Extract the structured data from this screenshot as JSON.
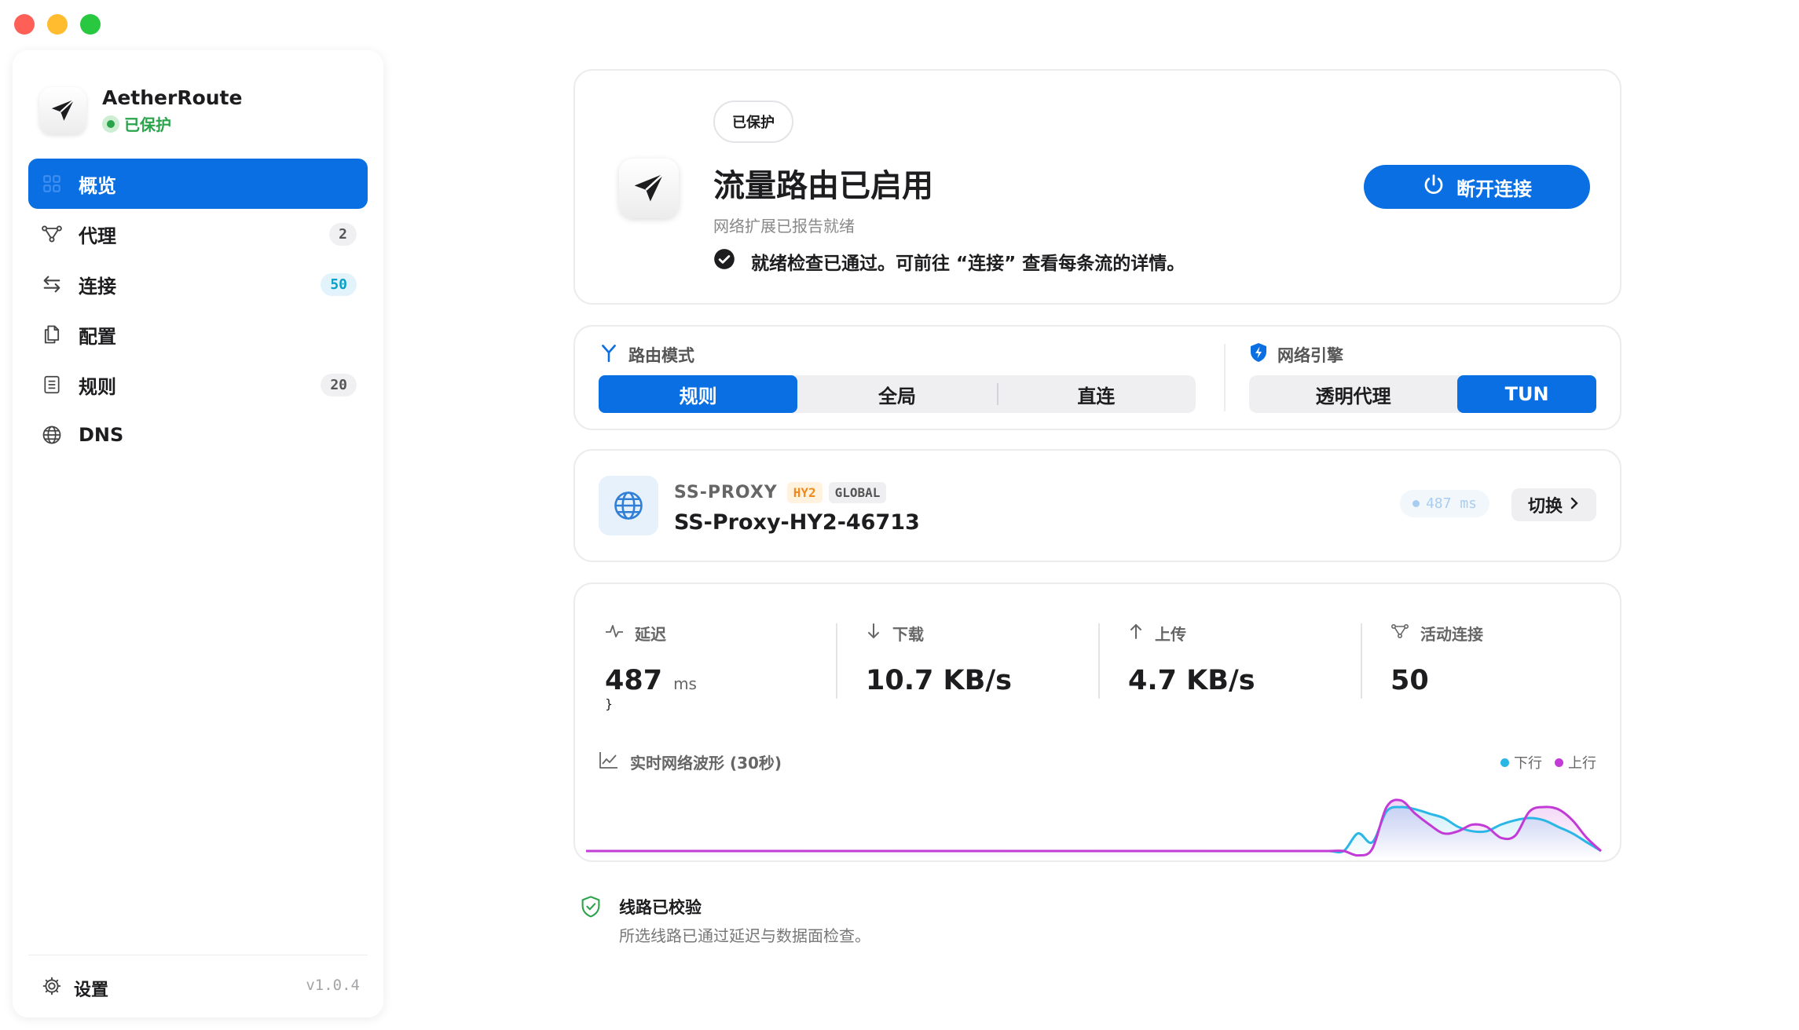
{
  "app": {
    "name": "AetherRoute",
    "status": "已保护",
    "version": "v1.0.4"
  },
  "colors": {
    "accent": "#0a6fe3",
    "success": "#2aa44a",
    "down": "#2bb7e6",
    "up": "#c23bd6"
  },
  "sidebar": {
    "items": [
      {
        "label": "概览",
        "icon": "dashboard-icon",
        "badge": ""
      },
      {
        "label": "代理",
        "icon": "nodes-icon",
        "badge": "2"
      },
      {
        "label": "连接",
        "icon": "swap-arrows-icon",
        "badge": "50"
      },
      {
        "label": "配置",
        "icon": "documents-icon",
        "badge": ""
      },
      {
        "label": "规则",
        "icon": "rule-list-icon",
        "badge": "20"
      },
      {
        "label": "DNS",
        "icon": "globe-icon",
        "badge": ""
      }
    ],
    "settings_label": "设置"
  },
  "hero": {
    "pill": "已保护",
    "title": "流量路由已启用",
    "subtitle": "网络扩展已报告就绪",
    "check_text": "就绪检查已通过。可前往 “连接” 查看每条流的详情。",
    "disconnect_label": "断开连接"
  },
  "modes": {
    "routing_label": "路由模式",
    "routing_options": [
      "规则",
      "全局",
      "直连"
    ],
    "routing_selected": "规则",
    "engine_label": "网络引擎",
    "engine_options": [
      "透明代理",
      "TUN"
    ],
    "engine_selected": "TUN"
  },
  "proxy": {
    "type": "SS-PROXY",
    "tag_protocol": "HY2",
    "tag_scope": "GLOBAL",
    "name": "SS-Proxy-HY2-46713",
    "latency": "487 ms",
    "switch_label": "切换"
  },
  "stats": {
    "latency_label": "延迟",
    "latency_value": "487",
    "latency_unit": "ms",
    "download_label": "下载",
    "download_value": "10.7 KB/s",
    "upload_label": "上传",
    "upload_value": "4.7 KB/s",
    "connections_label": "活动连接",
    "connections_value": "50"
  },
  "wave": {
    "title": "实时网络波形 (30秒)",
    "legend_down": "下行",
    "legend_up": "上行",
    "down_series": [
      0,
      0,
      0,
      0,
      0,
      0,
      0,
      0,
      0,
      0,
      0,
      0,
      0,
      0,
      0,
      0,
      0,
      0,
      0,
      0,
      0,
      0,
      0,
      0,
      0,
      0,
      0,
      0,
      0,
      0,
      0,
      0,
      0,
      0,
      0,
      0,
      0,
      0,
      0,
      0,
      0,
      0,
      0,
      0,
      0,
      0,
      0,
      0,
      0,
      0,
      0,
      0,
      0,
      0,
      0.4,
      0.2,
      0.9,
      1.0,
      0.95,
      0.85,
      0.75,
      0.55,
      0.45,
      0.45,
      0.6,
      0.7,
      0.75,
      0.7,
      0.55,
      0.4,
      0.2,
      0
    ],
    "up_series": [
      0,
      0,
      0,
      0,
      0,
      0,
      0,
      0,
      0,
      0,
      0,
      0,
      0,
      0,
      0,
      0,
      0,
      0,
      0,
      0,
      0,
      0,
      0,
      0,
      0,
      0,
      0,
      0,
      0,
      0,
      0,
      0,
      0,
      0,
      0,
      0,
      0,
      0,
      0,
      0,
      0,
      0,
      0,
      0,
      0,
      0,
      0,
      0,
      0,
      0,
      0,
      0,
      0,
      0,
      -0.1,
      0.05,
      1.0,
      1.15,
      0.85,
      0.6,
      0.4,
      0.45,
      0.6,
      0.55,
      0.3,
      0.35,
      0.9,
      1.0,
      0.95,
      0.7,
      0.3,
      0
    ]
  },
  "verify": {
    "title": "线路已校验",
    "subtitle": "所选线路已通过延迟与数据面检查。"
  }
}
